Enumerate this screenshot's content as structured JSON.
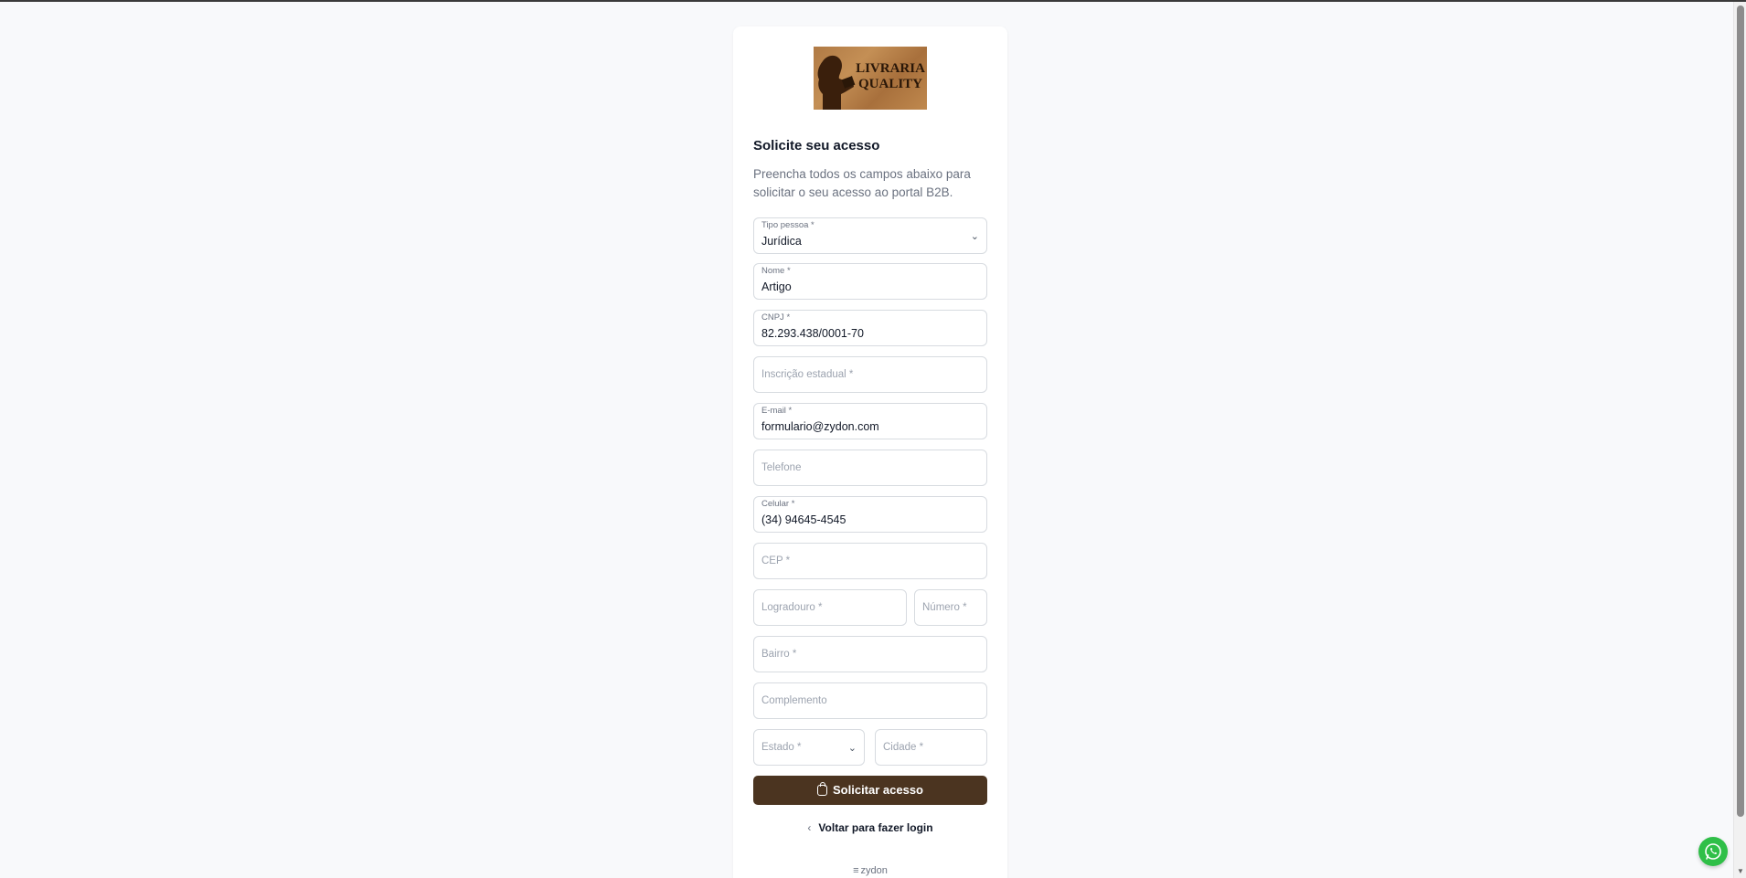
{
  "brand": {
    "logo_line1": "LIVRARIA",
    "logo_line2": "QUALITY"
  },
  "form": {
    "title": "Solicite seu acesso",
    "subtitle": "Preencha todos os campos abaixo para solicitar o seu acesso ao portal B2B.",
    "tipo_pessoa": {
      "label": "Tipo pessoa *",
      "value": "Jurídica"
    },
    "nome": {
      "label": "Nome *",
      "value": "Artigo"
    },
    "cnpj": {
      "label": "CNPJ *",
      "value": "82.293.438/0001-70"
    },
    "inscricao_estadual": {
      "placeholder": "Inscrição estadual *"
    },
    "email": {
      "label": "E-mail *",
      "value": "formulario@zydon.com"
    },
    "telefone": {
      "placeholder": "Telefone"
    },
    "celular": {
      "label": "Celular *",
      "value": "(34) 94645-4545"
    },
    "cep": {
      "placeholder": "CEP *"
    },
    "logradouro": {
      "placeholder": "Logradouro *"
    },
    "numero": {
      "placeholder": "Número *"
    },
    "bairro": {
      "placeholder": "Bairro *"
    },
    "complemento": {
      "placeholder": "Complemento"
    },
    "estado": {
      "placeholder": "Estado *"
    },
    "cidade": {
      "placeholder": "Cidade *"
    },
    "submit_label": "Solicitar acesso",
    "back_label": "Voltar para fazer login"
  },
  "footer": {
    "powered_by": "zydon"
  },
  "colors": {
    "primary_button": "#4b3420",
    "whatsapp": "#2fbf48",
    "background": "#f8f9fb"
  },
  "icons": {
    "submit": "lock-icon",
    "back": "chevron-left-icon",
    "whatsapp": "whatsapp-icon",
    "footer": "zydon-logo-icon"
  }
}
